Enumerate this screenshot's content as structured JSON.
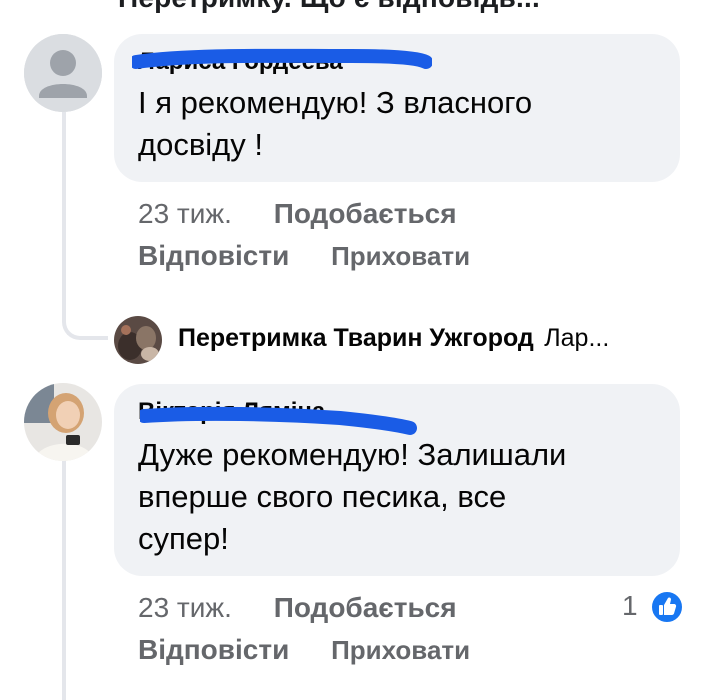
{
  "header": {
    "cut_text": "Перетримку. Що є відповідь..."
  },
  "comments": [
    {
      "author": "Лариса Гордеева",
      "text_line1": "І я рекомендую! З власного",
      "text_line2": "досвіду !",
      "time": "23 тиж.",
      "like": "Подобається",
      "reply": "Відповісти",
      "hide": "Приховати"
    },
    {
      "author": "Вікторія Ляміна",
      "text_line1": "Дуже рекомендую! Залишали",
      "text_line2": "вперше свого песика, все",
      "text_line3": "супер!",
      "time": "23 тиж.",
      "like": "Подобається",
      "reply": "Відповісти",
      "hide": "Приховати",
      "reactions": {
        "count": "1",
        "icon": "thumbs-up-icon",
        "color": "#1877f2"
      }
    }
  ],
  "reply_preview": {
    "author": "Перетримка Тварин Ужгород",
    "snippet": "Лар..."
  },
  "colors": {
    "bubble": "#f0f2f5",
    "meta_text": "#65676b",
    "redaction": "#1a5ce6",
    "like_blue": "#1877f2"
  }
}
